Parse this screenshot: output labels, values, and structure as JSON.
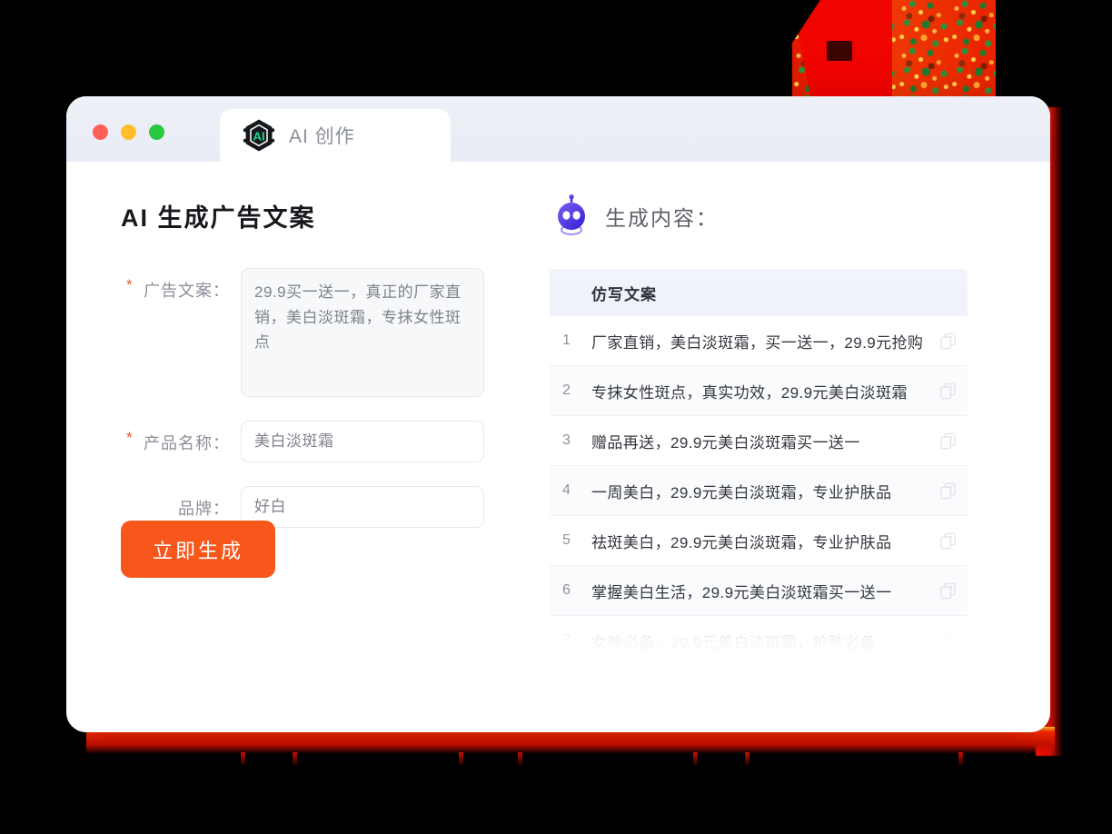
{
  "window": {
    "traffic_lights": [
      {
        "name": "close",
        "color": "#ff5f57"
      },
      {
        "name": "minimize",
        "color": "#ffbd2e"
      },
      {
        "name": "maximize",
        "color": "#28c840"
      }
    ],
    "tab_label": "AI 创作",
    "tab_logo_text": "AI"
  },
  "left": {
    "title": "AI 生成广告文案",
    "fields": [
      {
        "label": "广告文案：",
        "required": true,
        "value": "29.9买一送一，真正的厂家直销，美白淡斑霜，专抹女性斑点",
        "type": "textarea"
      },
      {
        "label": "产品名称：",
        "required": true,
        "value": "美白淡斑霜",
        "type": "input"
      },
      {
        "label": "品牌：",
        "required": false,
        "value": "好白",
        "type": "input"
      }
    ],
    "generate_button": "立即生成"
  },
  "right": {
    "title": "生成内容：",
    "table": {
      "header": "仿写文案",
      "rows": [
        {
          "num": "1",
          "text": "厂家直销，美白淡斑霜，买一送一，29.9元抢购"
        },
        {
          "num": "2",
          "text": "专抹女性斑点，真实功效，29.9元美白淡斑霜"
        },
        {
          "num": "3",
          "text": "赠品再送，29.9元美白淡斑霜买一送一"
        },
        {
          "num": "4",
          "text": "一周美白，29.9元美白淡斑霜，专业护肤品"
        },
        {
          "num": "5",
          "text": "祛斑美白，29.9元美白淡斑霜，专业护肤品"
        },
        {
          "num": "6",
          "text": "掌握美白生活，29.9元美白淡斑霜买一送一"
        },
        {
          "num": "7",
          "text": "女神必备，29.9元美白淡斑霜，护肤必备"
        }
      ]
    }
  },
  "colors": {
    "accent_orange": "#f8571c",
    "required_star": "#f5562a",
    "logo_green": "#19d68a",
    "robot_purple": "#4c3ce0",
    "glow_red": "#ff1400",
    "title_text": "#16181d"
  }
}
